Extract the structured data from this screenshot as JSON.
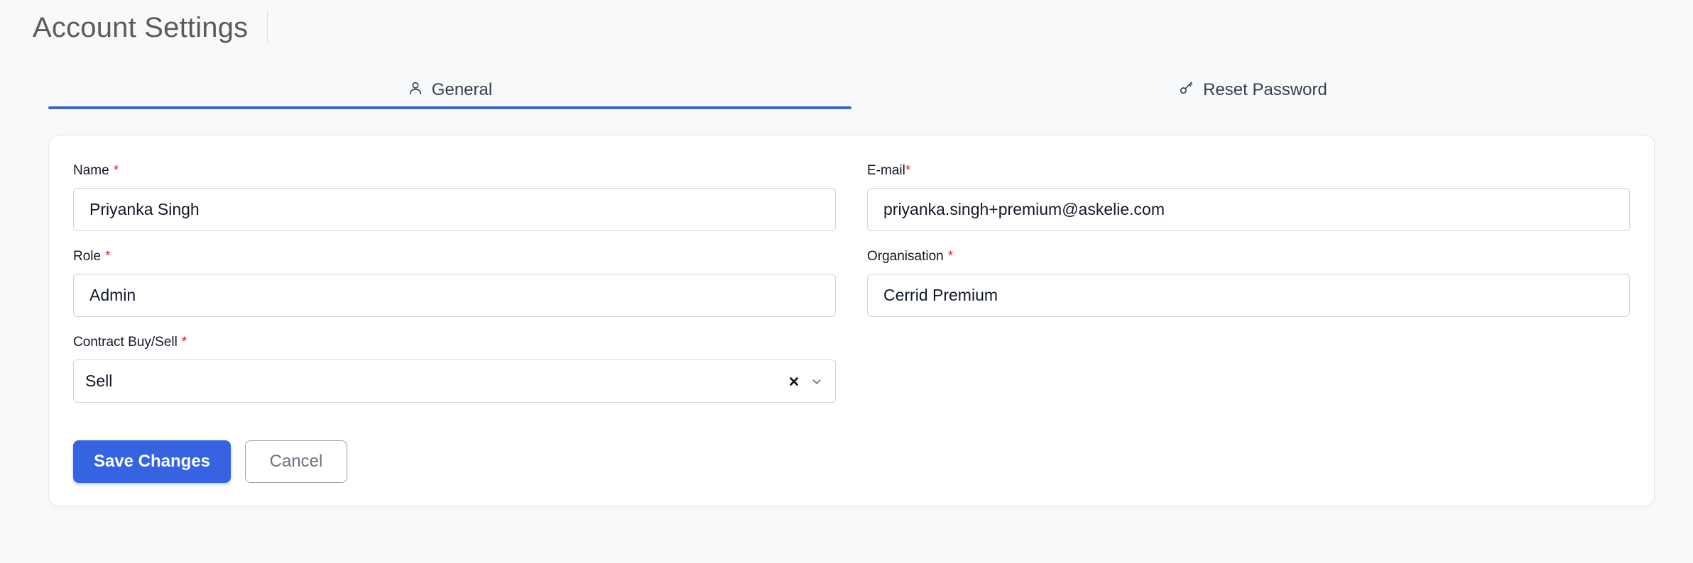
{
  "header": {
    "title": "Account Settings"
  },
  "tabs": [
    {
      "label": "General",
      "icon": "user-icon",
      "active": true
    },
    {
      "label": "Reset Password",
      "icon": "key-icon",
      "active": false
    }
  ],
  "form": {
    "name": {
      "label": "Name",
      "required": "*",
      "value": "Priyanka Singh"
    },
    "email": {
      "label": "E-mail",
      "required": "*",
      "value": "priyanka.singh+premium@askelie.com"
    },
    "role": {
      "label": "Role",
      "required": "*",
      "value": "Admin"
    },
    "organisation": {
      "label": "Organisation",
      "required": "*",
      "value": "Cerrid Premium"
    },
    "contract": {
      "label": "Contract Buy/Sell",
      "required": "*",
      "value": "Sell"
    }
  },
  "actions": {
    "save_label": "Save Changes",
    "cancel_label": "Cancel"
  },
  "colors": {
    "accent": "#3563e1",
    "tab_underline": "#3b66c9",
    "required": "#e11d2e"
  }
}
